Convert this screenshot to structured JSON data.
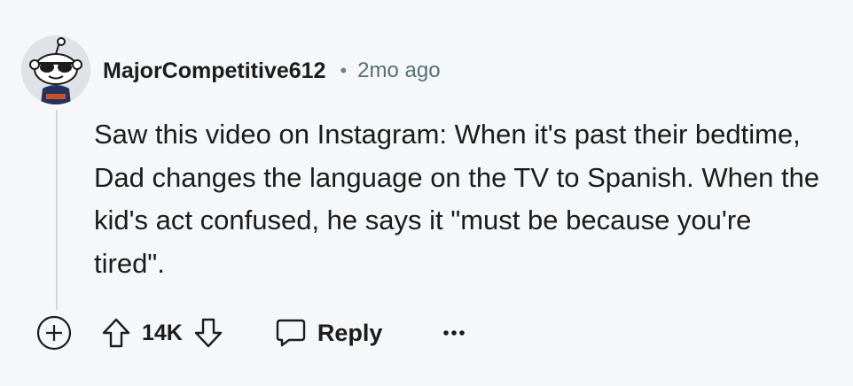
{
  "comment": {
    "username": "MajorCompetitive612",
    "separator": "•",
    "time": "2mo ago",
    "body": "Saw this video on Instagram: When it's past their bedtime, Dad changes the language on the TV to Spanish. When the kid's act confused, he says it \"must be because you're tired\".",
    "score": "14K",
    "reply_label": "Reply"
  },
  "icons": {
    "avatar": "snoo-avatar-with-sunglasses",
    "expand": "plus-circle-icon",
    "upvote": "arrow-up-icon",
    "downvote": "arrow-down-icon",
    "reply": "speech-bubble-icon",
    "more": "ellipsis-icon"
  },
  "colors": {
    "background": "#f6f7f8",
    "text": "#1c1c1c",
    "secondary_text": "#576f76"
  }
}
